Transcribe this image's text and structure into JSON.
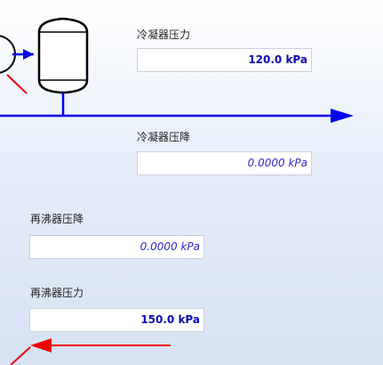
{
  "condenser": {
    "pressure_label": "冷凝器压力",
    "pressure_value": "120.0 kPa",
    "pressure_drop_label": "冷凝器压降",
    "pressure_drop_value": "0.0000 kPa"
  },
  "reboiler": {
    "pressure_drop_label": "再沸器压降",
    "pressure_drop_value": "0.0000 kPa",
    "pressure_label": "再沸器压力",
    "pressure_value": "150.0 kPa"
  },
  "colors": {
    "stream_blue": "#0000ee",
    "stream_red": "#ee0000",
    "equipment_outline": "#000000"
  }
}
